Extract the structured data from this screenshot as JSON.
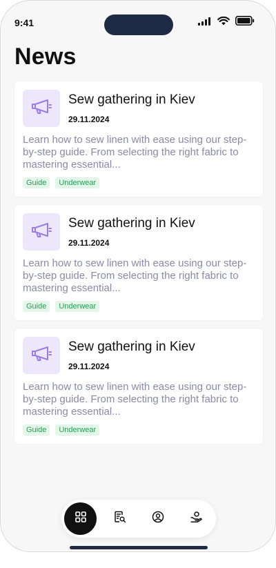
{
  "status_bar": {
    "time": "9:41"
  },
  "page": {
    "title": "News"
  },
  "news": [
    {
      "icon": "megaphone-icon",
      "title": "Sew gathering in Kiev",
      "date": "29.11.2024",
      "description": "Learn how to sew linen with ease using our step-by-step guide. From selecting the right fabric to mastering essential...",
      "tags": [
        "Guide",
        "Underwear"
      ]
    },
    {
      "icon": "megaphone-icon",
      "title": "Sew gathering in Kiev",
      "date": "29.11.2024",
      "description": "Learn how to sew linen with ease using our step-by-step guide. From selecting the right fabric to mastering essential...",
      "tags": [
        "Guide",
        "Underwear"
      ]
    },
    {
      "icon": "megaphone-icon",
      "title": "Sew gathering in Kiev",
      "date": "29.11.2024",
      "description": "Learn how to sew linen with ease using our step-by-step guide. From selecting the right fabric to mastering essential...",
      "tags": [
        "Guide",
        "Underwear"
      ]
    }
  ],
  "tabbar": {
    "items": [
      {
        "icon": "grid-icon",
        "active": true
      },
      {
        "icon": "document-search-icon",
        "active": false
      },
      {
        "icon": "user-circle-icon",
        "active": false
      },
      {
        "icon": "hand-care-icon",
        "active": false
      }
    ]
  },
  "colors": {
    "accent_purple": "#9b7be6",
    "icon_bg": "#ece7fb",
    "tag_text": "#2b9a55",
    "tag_bg": "#e3f6ea",
    "desc_text": "#8a8aa6",
    "active_tab": "#111111"
  }
}
